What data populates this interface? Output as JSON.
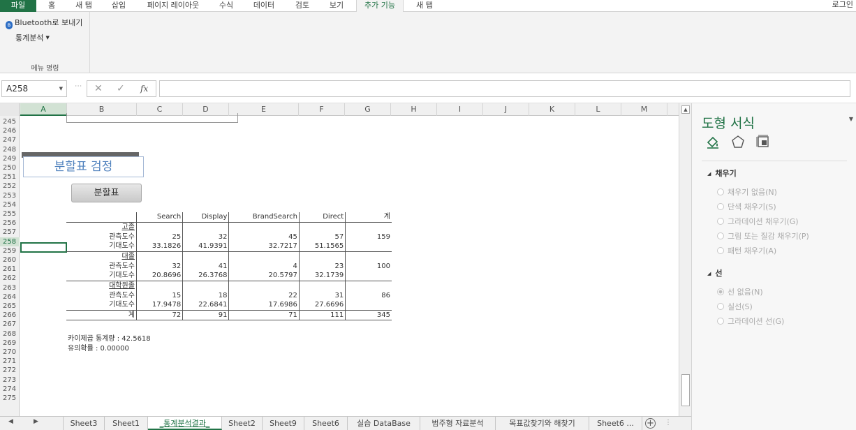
{
  "ribbon_tabs": [
    "파일",
    "홈",
    "새 탭",
    "삽입",
    "페이지 레이아웃",
    "수식",
    "데이터",
    "검토",
    "보기",
    "추가 기능",
    "새 탭"
  ],
  "login": "로그인",
  "ribbon": {
    "bluetooth": "Bluetooth로 보내기",
    "stats": "통계분석",
    "group_label": "메뉴 명령"
  },
  "formula_bar": {
    "name_box": "A258",
    "value": ""
  },
  "columns": [
    "A",
    "B",
    "C",
    "D",
    "E",
    "F",
    "G",
    "H",
    "I",
    "J",
    "K",
    "L",
    "M"
  ],
  "rows": [
    "245",
    "246",
    "247",
    "248",
    "249",
    "250",
    "251",
    "252",
    "253",
    "254",
    "255",
    "256",
    "257",
    "258",
    "259",
    "260",
    "261",
    "262",
    "263",
    "264",
    "265",
    "266",
    "267",
    "268",
    "269",
    "270",
    "271",
    "272",
    "273",
    "274",
    "275"
  ],
  "selected_row": "258",
  "sheet": {
    "title": "분할표 검정",
    "button": "분할표",
    "table": {
      "headers": [
        "Search",
        "Display",
        "BrandSearch",
        "Direct",
        "계"
      ],
      "groups": [
        {
          "name": "고졸",
          "obs_label": "관측도수",
          "exp_label": "기대도수",
          "obs": [
            "25",
            "32",
            "45",
            "57"
          ],
          "exp": [
            "33.1826",
            "41.9391",
            "32.7217",
            "51.1565"
          ],
          "total": "159"
        },
        {
          "name": "대졸",
          "obs_label": "관측도수",
          "exp_label": "기대도수",
          "obs": [
            "32",
            "41",
            "4",
            "23"
          ],
          "exp": [
            "20.8696",
            "26.3768",
            "20.5797",
            "32.1739"
          ],
          "total": "100"
        },
        {
          "name": "대학원졸",
          "obs_label": "관측도수",
          "exp_label": "기대도수",
          "obs": [
            "15",
            "18",
            "22",
            "31"
          ],
          "exp": [
            "17.9478",
            "22.6841",
            "17.6986",
            "27.6696"
          ],
          "total": "86"
        }
      ],
      "total_label": "계",
      "totals": [
        "72",
        "91",
        "71",
        "111",
        "345"
      ]
    },
    "chi_square": "카이제곱 통계량 : 42.5618",
    "p_value": "유의확률 : 0.00000"
  },
  "pane": {
    "title": "도형 서식",
    "fill_section": "채우기",
    "fill_options": [
      "채우기 없음(N)",
      "단색 채우기(S)",
      "그라데이션 채우기(G)",
      "그림 또는 질감 채우기(P)",
      "패턴 채우기(A)"
    ],
    "line_section": "선",
    "line_options": [
      "선 없음(N)",
      "실선(S)",
      "그라데이션 선(G)"
    ]
  },
  "sheet_tabs": [
    "Sheet3",
    "Sheet1",
    "_통계분석결과_",
    "Sheet2",
    "Sheet9",
    "Sheet6",
    "실습 DataBase",
    "범주형 자료분석",
    "목표값찾기와 해찾기",
    "Sheet6 ..."
  ],
  "active_sheet": "_통계분석결과_",
  "icons": {
    "bluetooth": "bluetooth-icon",
    "fill": "paint-bucket-icon",
    "effects": "pentagon-icon",
    "size": "size-properties-icon",
    "add_sheet": "plus-circle-icon"
  },
  "colors": {
    "accent": "#217346",
    "title_blue": "#4f81bd",
    "file_tab": "#217346"
  }
}
